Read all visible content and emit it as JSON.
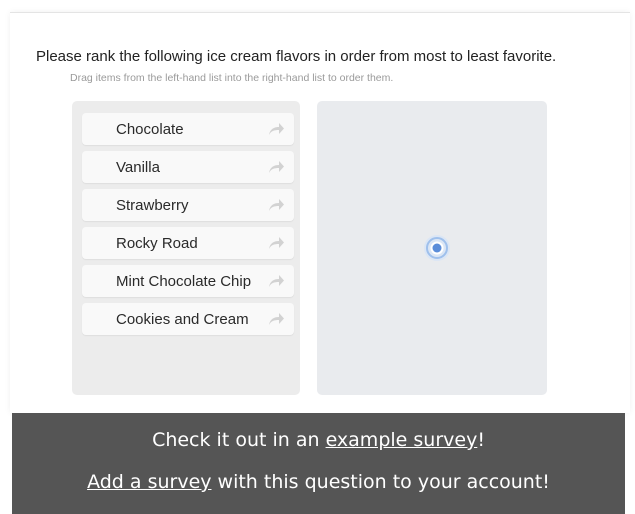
{
  "question": {
    "text": "Please rank the following ice cream flavors in order from most to least favorite.",
    "hint": "Drag items from the left-hand list into the right-hand list to order them."
  },
  "left_list": {
    "items": [
      {
        "label": "Chocolate",
        "icon": "share-arrow-icon"
      },
      {
        "label": "Vanilla",
        "icon": "share-arrow-icon"
      },
      {
        "label": "Strawberry",
        "icon": "share-arrow-icon"
      },
      {
        "label": "Rocky Road",
        "icon": "share-arrow-icon"
      },
      {
        "label": "Mint Chocolate Chip",
        "icon": "share-arrow-icon"
      },
      {
        "label": "Cookies and Cream",
        "icon": "share-arrow-icon"
      }
    ]
  },
  "right_list": {
    "items": [],
    "indicator_icon": "loading-spinner-icon"
  },
  "banner": {
    "line1_prefix": "Check it out in an ",
    "line1_link": "example survey",
    "line1_suffix": "!",
    "line2_link": "Add a survey",
    "line2_suffix": " with this question to your account!"
  },
  "colors": {
    "banner_bg": "#555555",
    "left_list_bg": "#ececec",
    "right_list_bg": "#e9ebee",
    "item_bg": "#f9f9f9",
    "spinner_accent": "#5b8dd9"
  }
}
